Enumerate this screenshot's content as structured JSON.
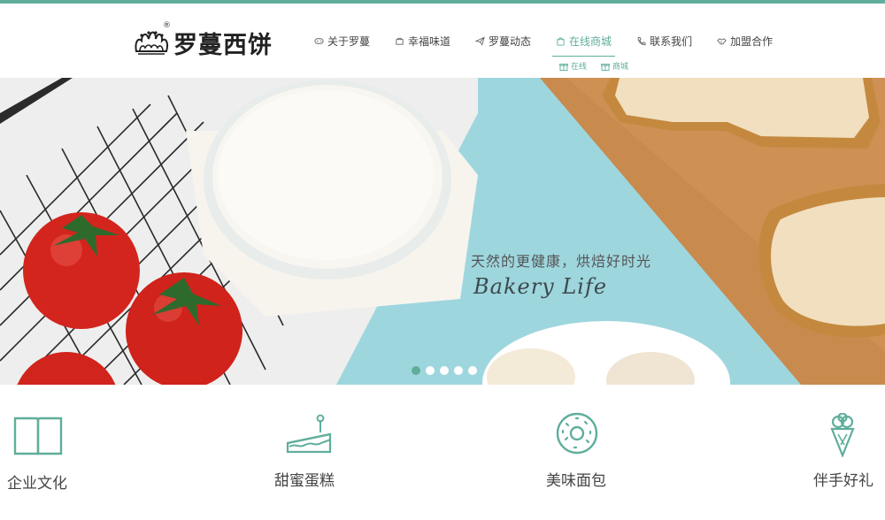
{
  "brand": {
    "name": "罗蔓西饼",
    "registered_mark": "®"
  },
  "nav": {
    "items": [
      {
        "label": "关于罗蔓",
        "icon": "gamepad-icon",
        "active": false
      },
      {
        "label": "幸福味道",
        "icon": "bag-icon",
        "active": false
      },
      {
        "label": "罗蔓动态",
        "icon": "paper-plane-icon",
        "active": false
      },
      {
        "label": "在线商城",
        "icon": "shopping-bag-icon",
        "active": true
      },
      {
        "label": "联系我们",
        "icon": "phone-icon",
        "active": false
      },
      {
        "label": "加盟合作",
        "icon": "handshake-icon",
        "active": false
      }
    ],
    "submenu": [
      {
        "label": "在线",
        "icon": "gift-icon"
      },
      {
        "label": "商城",
        "icon": "gift-icon"
      }
    ]
  },
  "hero": {
    "tagline": "天然的更健康，烘焙好时光",
    "script": "Bakery Life",
    "slide_count": 5,
    "active_slide": 1
  },
  "features": [
    {
      "label": "企业文化",
      "icon": "book-icon"
    },
    {
      "label": "甜蜜蛋糕",
      "icon": "cake-slice-icon"
    },
    {
      "label": "美味面包",
      "icon": "donut-icon"
    },
    {
      "label": "伴手好礼",
      "icon": "ice-cream-icon"
    }
  ],
  "colors": {
    "accent": "#5fae9c",
    "hero_background": "#9ed6de",
    "text": "#444444"
  }
}
